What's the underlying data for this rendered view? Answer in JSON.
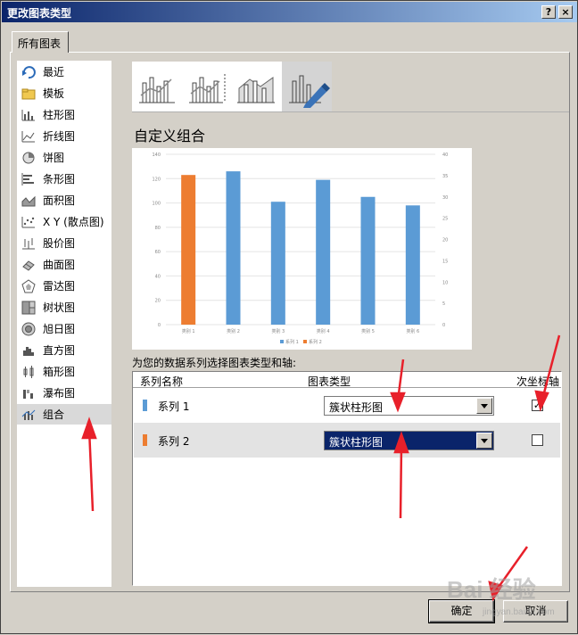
{
  "window": {
    "title": "更改图表类型",
    "help_label": "?",
    "close_label": "×"
  },
  "tab": {
    "label": "所有图表"
  },
  "sidebar": {
    "items": [
      {
        "label": "最近",
        "icon": "recent-icon"
      },
      {
        "label": "模板",
        "icon": "folder-icon"
      },
      {
        "label": "柱形图",
        "icon": "column-chart-icon"
      },
      {
        "label": "折线图",
        "icon": "line-chart-icon"
      },
      {
        "label": "饼图",
        "icon": "pie-chart-icon"
      },
      {
        "label": "条形图",
        "icon": "bar-chart-icon"
      },
      {
        "label": "面积图",
        "icon": "area-chart-icon"
      },
      {
        "label": "X Y (散点图)",
        "icon": "scatter-chart-icon"
      },
      {
        "label": "股价图",
        "icon": "stock-chart-icon"
      },
      {
        "label": "曲面图",
        "icon": "surface-chart-icon"
      },
      {
        "label": "雷达图",
        "icon": "radar-chart-icon"
      },
      {
        "label": "树状图",
        "icon": "treemap-chart-icon"
      },
      {
        "label": "旭日图",
        "icon": "sunburst-chart-icon"
      },
      {
        "label": "直方图",
        "icon": "histogram-chart-icon"
      },
      {
        "label": "箱形图",
        "icon": "boxplot-chart-icon"
      },
      {
        "label": "瀑布图",
        "icon": "waterfall-chart-icon"
      },
      {
        "label": "组合",
        "icon": "combo-chart-icon"
      }
    ],
    "selected_index": 16
  },
  "subtypes": {
    "items": [
      "combo-column-line-icon",
      "combo-column-line-secondary-icon",
      "combo-area-column-icon",
      "custom-combo-icon"
    ],
    "selected_index": 3
  },
  "section": {
    "title": "自定义组合"
  },
  "chart_data": {
    "type": "bar",
    "categories": [
      "类别 1",
      "类别 2",
      "类别 3",
      "类别 4",
      "类别 5",
      "类别 6"
    ],
    "series": [
      {
        "name": "系列 1",
        "values": [
          null,
          126,
          101,
          119,
          105,
          98
        ],
        "color": "#5b9bd5"
      },
      {
        "name": "系列 2",
        "values": [
          123,
          null,
          null,
          null,
          null,
          null
        ],
        "color": "#ed7d31"
      }
    ],
    "ylim": [
      0,
      140
    ],
    "yticks": [
      0,
      20,
      40,
      60,
      80,
      100,
      120,
      140
    ],
    "y2lim": [
      0,
      40
    ],
    "y2ticks": [
      0,
      5,
      10,
      15,
      20,
      25,
      30,
      35,
      40
    ],
    "legend": "bottom"
  },
  "instruction": "为您的数据系列选择图表类型和轴:",
  "table": {
    "headers": {
      "name": "系列名称",
      "type": "图表类型",
      "secondary": "次坐标轴"
    },
    "rows": [
      {
        "name": "系列 1",
        "color": "#5b9bd5",
        "type": "簇状柱形图",
        "secondary_checked": true,
        "check_mark": "✓"
      },
      {
        "name": "系列 2",
        "color": "#ed7d31",
        "type": "簇状柱形图",
        "secondary_checked": false,
        "check_mark": ""
      }
    ]
  },
  "buttons": {
    "ok": "确定",
    "cancel": "取消"
  },
  "watermark": {
    "text": "Bai 经验",
    "url": "jingyan.baidu.com"
  }
}
